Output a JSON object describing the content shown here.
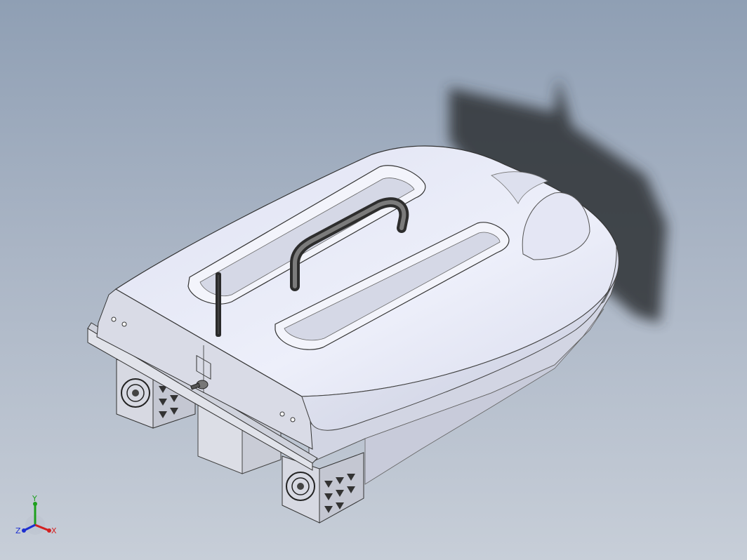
{
  "viewport": {
    "background_top": "#8f9fb4",
    "background_bottom": "#c7ced8",
    "model_color": "#e6e9f6",
    "shadow_color": "#2d3036"
  },
  "triad": {
    "x_label": "X",
    "y_label": "Y",
    "z_label": "Z",
    "x_color": "#d42020",
    "y_color": "#1ea01e",
    "z_color": "#1d2fd0"
  }
}
